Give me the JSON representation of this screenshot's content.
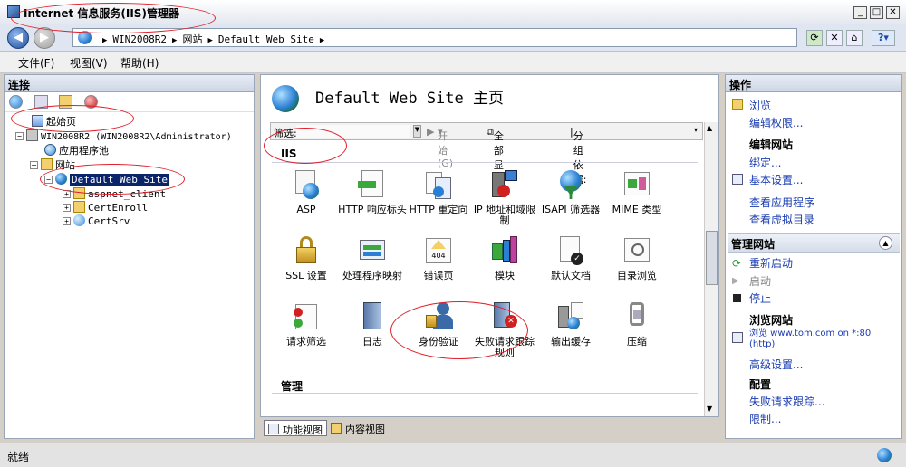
{
  "window": {
    "title": "Internet 信息服务(IIS)管理器",
    "min": "_",
    "max": "□",
    "close": "✕"
  },
  "address": {
    "crumbs": [
      "WIN2008R2",
      "网站",
      "Default Web Site"
    ]
  },
  "toolbar_icons": [
    "refresh-icon",
    "stop-icon",
    "home-icon",
    "help-icon"
  ],
  "menu": [
    "文件(F)",
    "视图(V)",
    "帮助(H)"
  ],
  "connections": {
    "header": "连接",
    "tree": {
      "start_page": "起始页",
      "server": "WIN2008R2 (WIN2008R2\\Administrator)",
      "app_pools": "应用程序池",
      "sites": "网站",
      "default_site": "Default Web Site",
      "children": [
        "aspnet_client",
        "CertEnroll",
        "CertSrv"
      ]
    }
  },
  "main": {
    "title": "Default Web Site 主页",
    "filter_label": "筛选:",
    "start_label": "开始(G)",
    "show_all": "全部显示(A)",
    "group_by": "分组依据:",
    "section_iis": "IIS",
    "section_manage": "管理",
    "features": [
      {
        "label": "ASP",
        "icon": "asp-icon"
      },
      {
        "label": "HTTP 响应标头",
        "icon": "http-response-headers-icon"
      },
      {
        "label": "HTTP 重定向",
        "icon": "http-redirect-icon"
      },
      {
        "label": "IP 地址和域限制",
        "icon": "ip-restrictions-icon"
      },
      {
        "label": "ISAPI 筛选器",
        "icon": "isapi-filters-icon"
      },
      {
        "label": "MIME 类型",
        "icon": "mime-types-icon"
      },
      {
        "label": "SSL 设置",
        "icon": "ssl-lock-icon"
      },
      {
        "label": "处理程序映射",
        "icon": "handler-mappings-icon"
      },
      {
        "label": "错误页",
        "icon": "error-pages-icon"
      },
      {
        "label": "模块",
        "icon": "modules-icon"
      },
      {
        "label": "默认文档",
        "icon": "default-document-icon"
      },
      {
        "label": "目录浏览",
        "icon": "directory-browsing-icon"
      },
      {
        "label": "请求筛选",
        "icon": "request-filtering-icon"
      },
      {
        "label": "日志",
        "icon": "logging-icon"
      },
      {
        "label": "身份验证",
        "icon": "authentication-icon"
      },
      {
        "label": "失败请求跟踪规则",
        "icon": "failed-request-tracing-icon"
      },
      {
        "label": "输出缓存",
        "icon": "output-caching-icon"
      },
      {
        "label": "压缩",
        "icon": "compression-icon"
      }
    ],
    "error_page_text": "404",
    "view_feature": "功能视图",
    "view_content": "内容视图"
  },
  "actions": {
    "header": "操作",
    "browse": "浏览",
    "edit_permissions": "编辑权限...",
    "edit_site": "编辑网站",
    "bindings": "绑定...",
    "basic_settings": "基本设置...",
    "view_applications": "查看应用程序",
    "view_virtual_dirs": "查看虚拟目录",
    "manage_site": "管理网站",
    "restart": "重新启动",
    "start": "启动",
    "stop": "停止",
    "browse_site": "浏览网站",
    "browse_link": "浏览 www.tom.com on *:80 (http)",
    "advanced_settings": "高级设置...",
    "config": "配置",
    "failed_request": "失败请求跟踪...",
    "limits": "限制..."
  },
  "status": "就绪",
  "colors": {
    "annotation": "#e0202a",
    "selection": "#0a246a",
    "link": "#1a3cb0"
  }
}
